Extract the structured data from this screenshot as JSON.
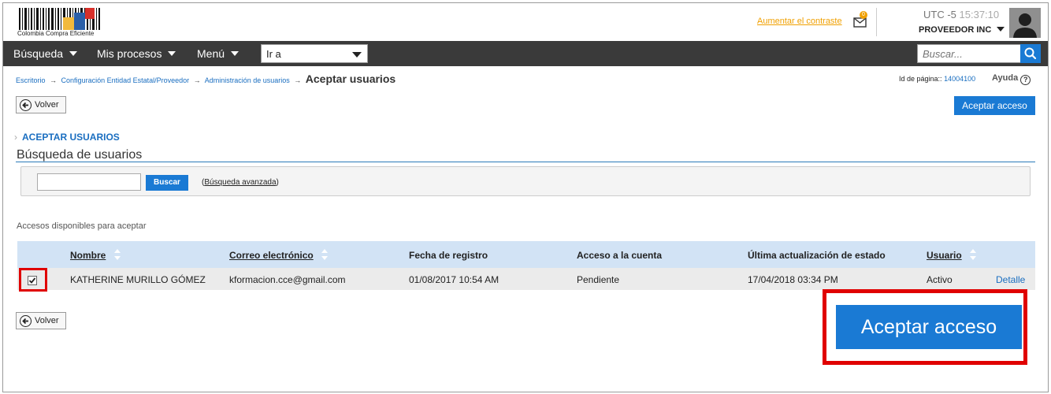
{
  "header": {
    "logo_text": "Colombia Compra Eficiente",
    "contrast_link": "Aumentar el contraste",
    "mail_count": "0",
    "utc_label": "UTC -5",
    "time": "15:37:10",
    "provider": "PROVEEDOR INC"
  },
  "nav": {
    "items": [
      {
        "label": "Búsqueda"
      },
      {
        "label": "Mis procesos"
      },
      {
        "label": "Menú"
      }
    ],
    "goto_value": "Ir a",
    "search_placeholder": "Buscar..."
  },
  "breadcrumb": {
    "crumbs": [
      "Escritorio",
      "Configuración Entidad Estatal/Proveedor",
      "Administración de usuarios"
    ],
    "separator": "→",
    "current": "Aceptar usuarios"
  },
  "page_info": {
    "id_label": "Id de página::",
    "id_value": "14004100",
    "help_label": "Ayuda",
    "help_symbol": "?"
  },
  "actions": {
    "back_label": "Volver",
    "accept_label": "Aceptar acceso"
  },
  "section": {
    "title": "ACEPTAR USUARIOS",
    "subtitle": "Búsqueda de usuarios"
  },
  "search": {
    "button_label": "Buscar",
    "open_paren": "(",
    "advanced_link": "Búsqueda avanzada",
    "close_paren": ")"
  },
  "table": {
    "caption": "Accesos disponibles para aceptar",
    "columns": [
      "Nombre",
      "Correo electrónico",
      "Fecha de registro",
      "Acceso a la cuenta",
      "Última actualización de estado",
      "Usuario"
    ],
    "rows": [
      {
        "checked": true,
        "name": "KATHERINE MURILLO GÓMEZ",
        "email": "kformacion.cce@gmail.com",
        "registered": "01/08/2017 10:54 AM",
        "access": "Pendiente",
        "last_update": "17/04/2018 03:34 PM",
        "user_status": "Activo",
        "detail_link": "Detalle"
      }
    ]
  },
  "colors": {
    "primary": "#1a7ad4",
    "nav_bg": "#3a3a3a",
    "link": "#1a6ec0",
    "highlight": "#e00000",
    "contrast_link": "#f0a000"
  }
}
